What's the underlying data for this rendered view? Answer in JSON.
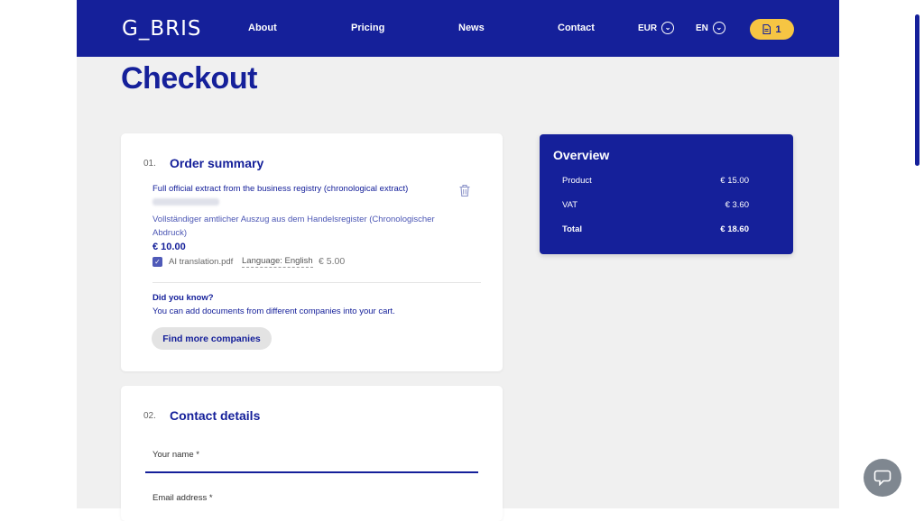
{
  "header": {
    "logo": "G_BRIS",
    "nav": [
      "About",
      "Pricing",
      "News",
      "Contact"
    ],
    "currency": "EUR",
    "language": "EN",
    "cart_count": "1"
  },
  "page_title": "Checkout",
  "order_summary": {
    "number": "01.",
    "title": "Order summary",
    "item": {
      "title": "Full official extract from the business registry (chronological extract)",
      "description": "Vollständiger amtlicher Auszug aus dem Handelsregister (Chronologischer Abdruck)",
      "price": "€ 10.00",
      "addon_label": "AI translation.pdf",
      "addon_language": "Language: English",
      "addon_price": "€ 5.00"
    },
    "did_you_know_title": "Did you know?",
    "did_you_know_text": "You can add documents from different companies into your cart.",
    "find_button": "Find more companies"
  },
  "contact_details": {
    "number": "02.",
    "title": "Contact details",
    "name_label": "Your name  *",
    "email_label": "Email address  *"
  },
  "overview": {
    "title": "Overview",
    "rows": [
      {
        "label": "Product",
        "value": "€ 15.00"
      },
      {
        "label": "VAT",
        "value": "€ 3.60"
      },
      {
        "label": "Total",
        "value": "€ 18.60"
      }
    ]
  },
  "colors": {
    "primary": "#15209a",
    "accent": "#f6c543",
    "background": "#f0f0f0"
  }
}
